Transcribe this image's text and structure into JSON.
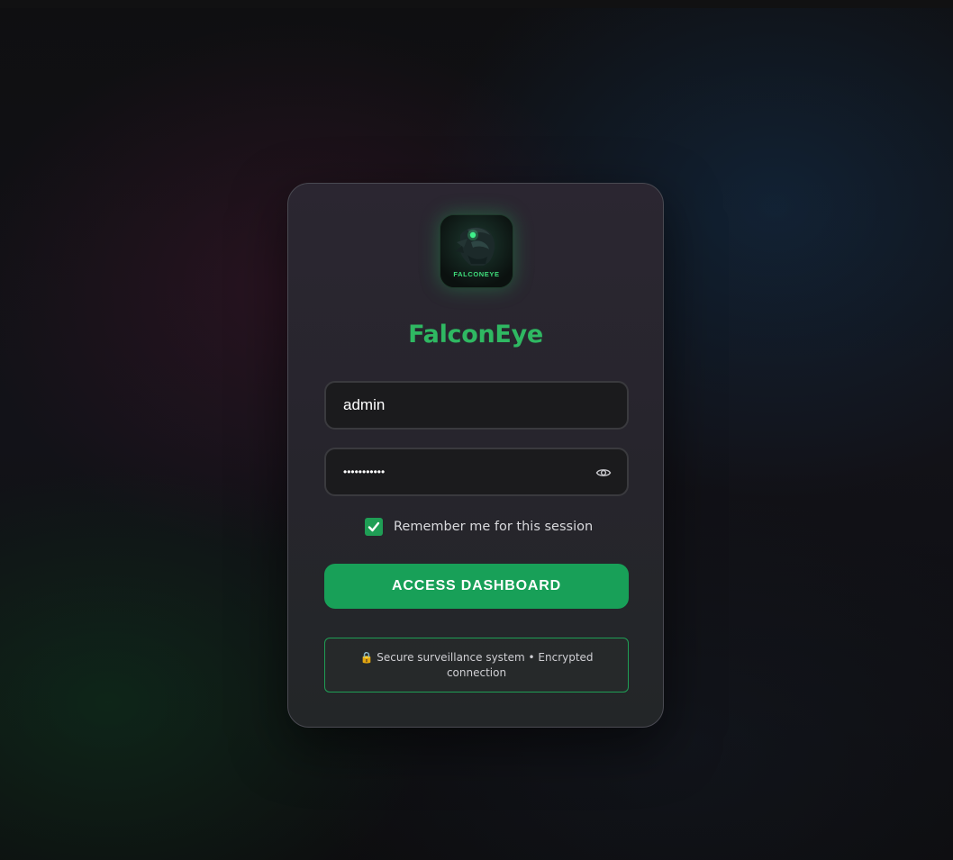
{
  "app": {
    "title": "FalconEye",
    "logo_text": "FALCONEYE",
    "accent_color": "#18a058",
    "title_color": "#2fb862"
  },
  "login": {
    "username_value": "admin",
    "password_value": "•••••••••••",
    "password_toggle_icon": "eye-icon",
    "remember_label": "Remember me for this session",
    "remember_checked": true,
    "submit_label": "ACCESS DASHBOARD"
  },
  "footer": {
    "lock_icon": "🔒",
    "notice_text": "Secure surveillance system • Encrypted connection"
  }
}
